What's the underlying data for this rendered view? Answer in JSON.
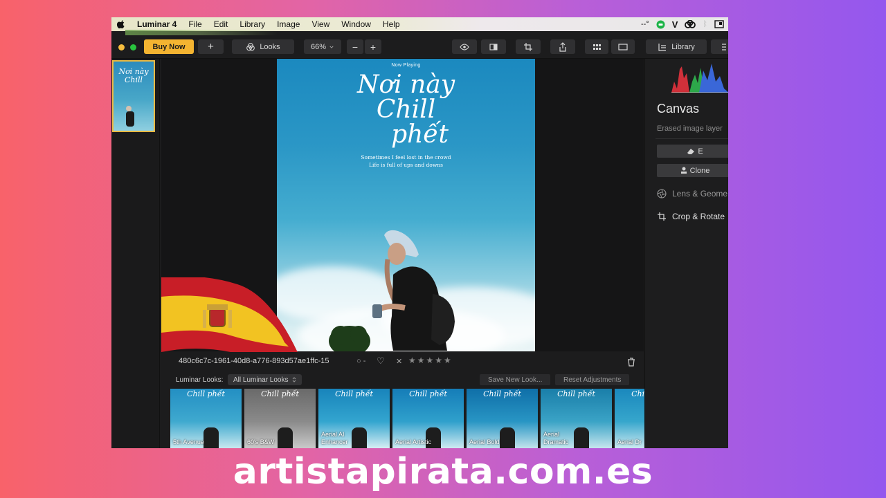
{
  "menubar": {
    "app_name": "Luminar 4",
    "items": [
      "File",
      "Edit",
      "Library",
      "Image",
      "View",
      "Window",
      "Help"
    ],
    "status": {
      "battery": "--°",
      "v_label": "V"
    }
  },
  "toolbar": {
    "buy_label": "Buy Now",
    "add_label": "+",
    "looks_label": "Looks",
    "zoom_value": "66%",
    "zoom_out_label": "−",
    "zoom_in_label": "+",
    "library_label": "Library"
  },
  "poster": {
    "now_playing": "Now Playing",
    "title_line1": "Nơi này",
    "title_line2": "Chill",
    "title_line3": "phết",
    "subtitle_line1": "Sometimes I feel lost in the crowd",
    "subtitle_line2": "Life is full of ups and downs"
  },
  "info": {
    "file_id": "480c6c7c-1961-40d8-a776-893d57ae1ffc-15",
    "rating_stars": "★★★★★",
    "reject_mark": "✕",
    "heart_mark": "♡",
    "circle_mark": "○ -"
  },
  "looks": {
    "label": "Luminar Looks:",
    "selected": "All Luminar Looks",
    "save_label": "Save New Look...",
    "reset_label": "Reset Adjustments",
    "mini_title": "Chill phết",
    "items": [
      {
        "name": "5th Avenue",
        "tone": "color"
      },
      {
        "name": "60's B&W",
        "tone": "bw"
      },
      {
        "name": "Aerial AI Enhancer",
        "tone": "color"
      },
      {
        "name": "Aerial Artistic",
        "tone": "color"
      },
      {
        "name": "Aerial Bold",
        "tone": "color"
      },
      {
        "name": "Aerial Dramatic",
        "tone": "color"
      },
      {
        "name": "Aerial Dr",
        "tone": "color"
      }
    ]
  },
  "panel": {
    "title": "Canvas",
    "description": "Erased image layer",
    "erase_label": "E",
    "clone_label": "Clone",
    "lens_label": "Lens & Geome",
    "crop_label": "Crop & Rotate"
  },
  "watermark": "artistapirata.com.es",
  "colors": {
    "accent": "#f4b431",
    "selection": "#e9b941",
    "panel_bg": "#1d1d1e"
  }
}
